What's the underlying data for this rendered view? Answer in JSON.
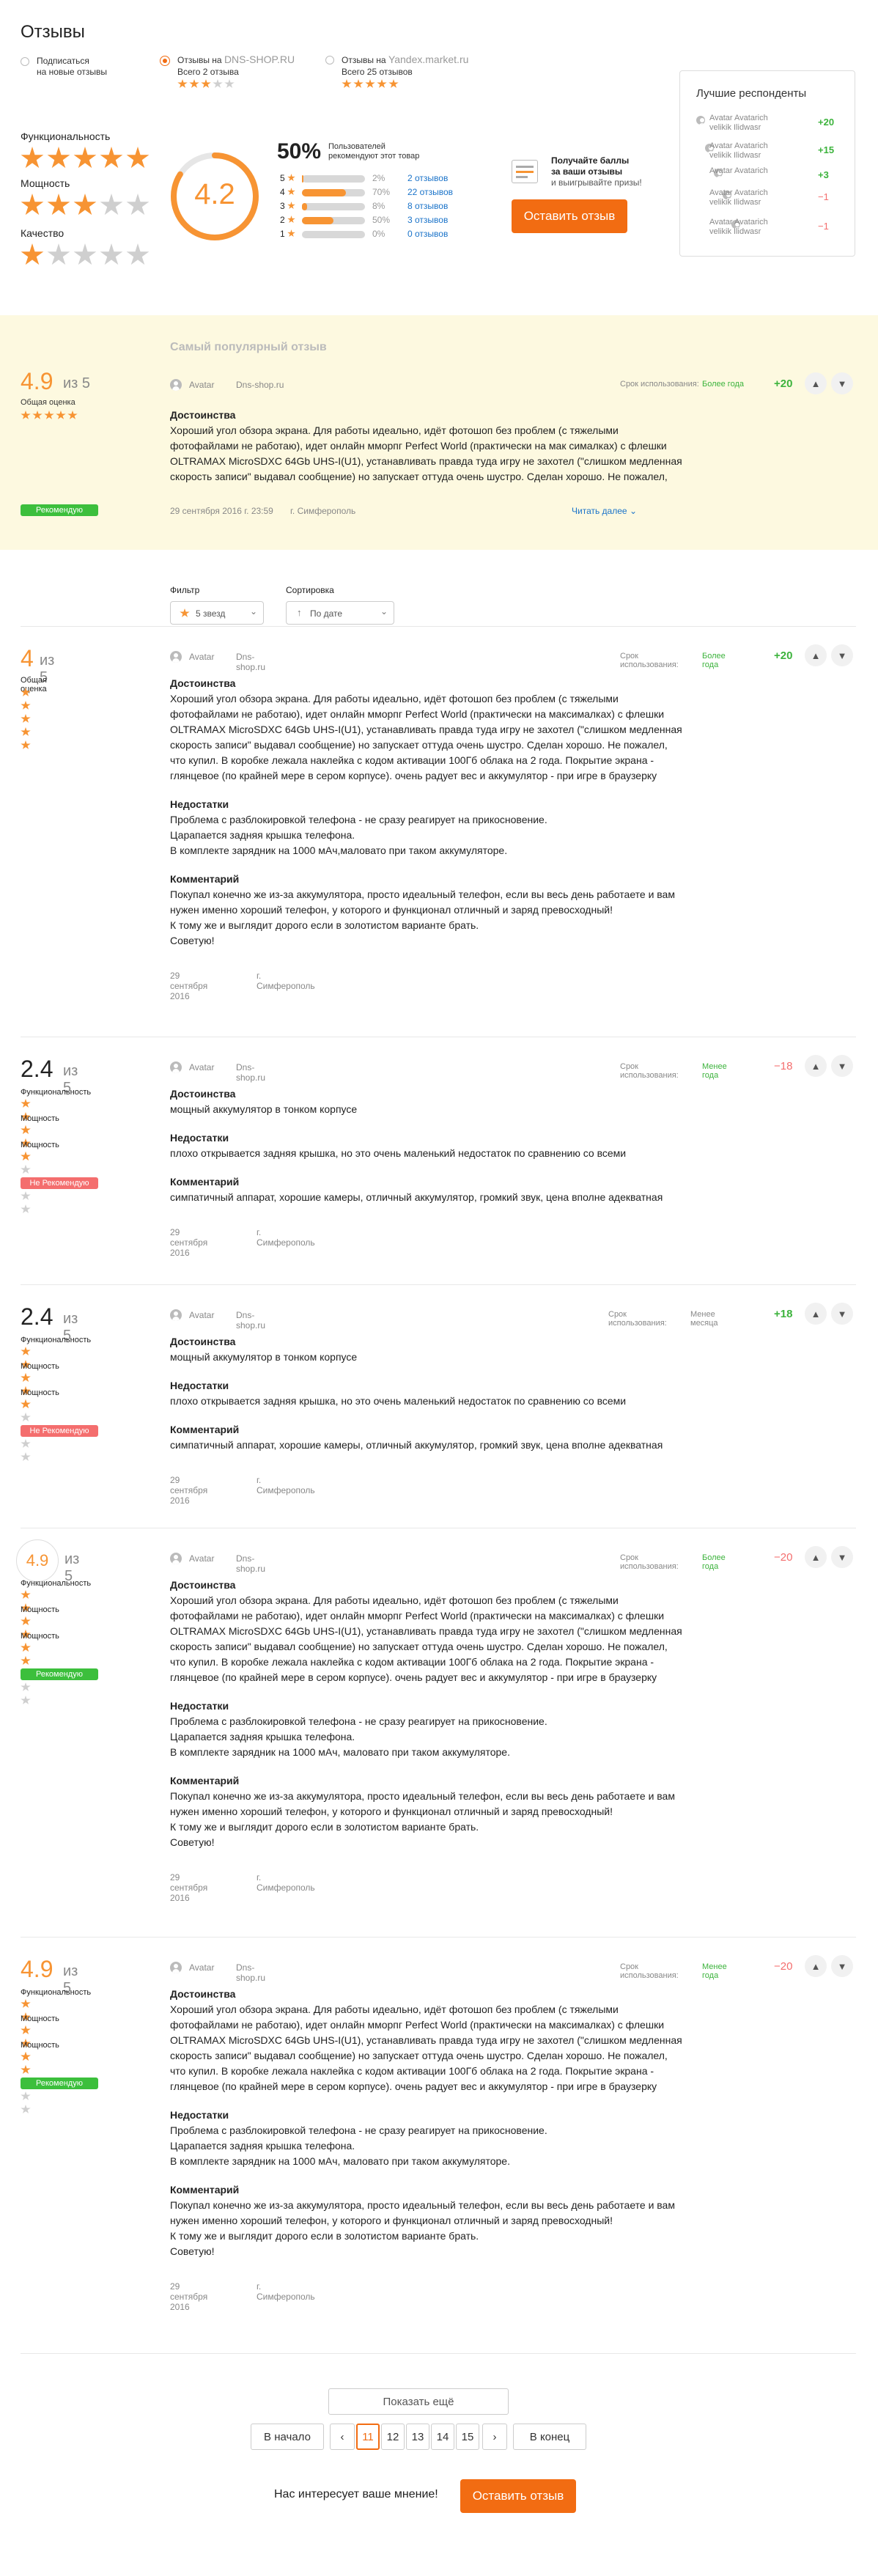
{
  "title": "Отзывы",
  "sources": {
    "subscribe": {
      "line1": "Подписаться",
      "line2": "на новые отзывы"
    },
    "dns": {
      "prefix": "Отзывы на",
      "name": "DNS-SHOP.RU",
      "total": "Всего 2 отзыва",
      "stars": 3
    },
    "yandex": {
      "prefix": "Отзывы на",
      "name": "Yandex.market.ru",
      "total": "Всего 25 отзывов",
      "stars": 5
    }
  },
  "criteria": [
    {
      "label": "Функциональность",
      "stars": 5
    },
    {
      "label": "Мощность",
      "stars": 3
    },
    {
      "label": "Качество",
      "stars": 1
    }
  ],
  "overall": {
    "score": "4.2",
    "percent": "50%",
    "percent_text_1": "Пользователей",
    "percent_text_2": "рекомендуют этот товар"
  },
  "distribution": [
    {
      "n": "5",
      "pct": "2%",
      "fill": 0.02,
      "link": "2 отзывов"
    },
    {
      "n": "4",
      "pct": "70%",
      "fill": 0.7,
      "link": "22 отзывов"
    },
    {
      "n": "3",
      "pct": "8%",
      "fill": 0.08,
      "link": "8 отзывов"
    },
    {
      "n": "2",
      "pct": "50%",
      "fill": 0.5,
      "link": "3 отзывов"
    },
    {
      "n": "1",
      "pct": "0%",
      "fill": 0,
      "link": "0 отзывов"
    }
  ],
  "promo": {
    "l1": "Получайте баллы",
    "l2": "за ваши отзывы",
    "l3": "и выигрывайте призы!"
  },
  "leave_review": "Оставить отзыв",
  "top_respondents": {
    "title": "Лучшие респонденты",
    "items": [
      {
        "l1": "Avatar Avatarich",
        "l2": "velikik Ilidwasr",
        "score": "+20",
        "type": "pos"
      },
      {
        "l1": "Avatar Avatarich",
        "l2": "velikik Ilidwasr",
        "score": "+15",
        "type": "pos"
      },
      {
        "l1": "Avatar Avatarich",
        "l2": "",
        "score": "+3",
        "type": "pos"
      },
      {
        "l1": "Avatar Avatarich",
        "l2": "velikik Ilidwasr",
        "score": "−1",
        "type": "neg"
      },
      {
        "l1": "Avatar Avatarich",
        "l2": "velikik Ilidwasr",
        "score": "−1",
        "type": "neg"
      }
    ]
  },
  "popular": {
    "label": "Самый популярный отзыв",
    "score": "4.9",
    "of": "из 5",
    "overall": "Общая оценка",
    "stars": 5,
    "badge": "Рекомендую",
    "author": "Avatar",
    "source": "Dns-shop.ru",
    "use_label": "Срок использования:",
    "use_value": "Более года",
    "votes": "+20",
    "h": "Достоинства",
    "text": [
      "Хороший угол обзора экрана. Для работы идеально, идёт фотошоп без проблем (с тяжелыми",
      "фотофайлами не работаю), идет онлайн ммоpпг Perfect World (практически на мак сималках) с флешки",
      "OLTRAMAX MicroSDXC 64Gb UHS-I(U1), устанавливать правда туда игру не захотел (\"слишком медленная",
      "скорость записи\" выдавал сообщение) но запускает оттуда очень шустро. Сделан хорошо. Не пожалел,"
    ],
    "date": "29 сентября 2016 г. 23:59",
    "city": "г. Симферополь",
    "more": "Читать далее"
  },
  "filter": {
    "label": "Фильтр",
    "value": "5 звезд"
  },
  "sort": {
    "label": "Сортировка",
    "value": "По дате"
  },
  "reviews": [
    {
      "score": "4",
      "of": "из 5",
      "overall": "Общая оценка",
      "stars": 5,
      "author": "Avatar",
      "source": "Dns-shop.ru",
      "use_label": "Срок использования:",
      "use_value": "Более года",
      "use_color": "#3cb33c",
      "votes": "+20",
      "vtype": "pos",
      "sections": [
        {
          "h": "Достоинства",
          "lines": [
            "Хороший угол обзора экрана. Для работы идеально, идёт фотошоп без проблем (с тяжелыми",
            "фотофайлами не работаю), идет онлайн ммоpпг Perfect World (практически на максималках) с флешки",
            "OLTRAMAX MicroSDXC 64Gb UHS-I(U1), устанавливать правда туда игру не захотел (\"слишком медленная",
            "скорость записи\" выдавал сообщение) но запускает оттуда очень шустро. Сделан хорошо. Не пожалел,",
            "что купил. В коробке лежала наклейка с кодом активации 100Гб облака на 2 года. Покрытие экрана -",
            "глянцевое (по крайней мере в сером корпусе). очень радует вес и аккумулятор - при игре в браузерку"
          ]
        },
        {
          "h": "Недостатки",
          "lines": [
            "Проблема с разблокировкой телефона - не сразу реагирует на прикосновение.",
            "Царапается задняя крышка телефона.",
            "В комплекте зарядник на 1000 мАч,маловато при таком аккумуляторе."
          ]
        },
        {
          "h": "Комментарий",
          "lines": [
            "Покупал конечно же из-за аккумулятора, просто идеальный телефон, если вы весь день работаете и вам",
            "нужен именно хороший телефон, у которого и функционал отличный и заряд превосходный!",
            "К тому же и выглядит дорого если в золотистом варианте брать.",
            "Советую!"
          ]
        }
      ],
      "date": "29 сентября 2016",
      "city": "г. Симферополь"
    },
    {
      "score": "2.4",
      "of": "из 5",
      "crit": [
        [
          "Функциональность",
          5
        ],
        [
          "Мощность",
          3
        ],
        [
          "Мощность",
          1
        ]
      ],
      "badge": "Не Рекомендую",
      "badge_type": "red",
      "author": "Avatar",
      "source": "Dns-shop.ru",
      "use_label": "Срок использования:",
      "use_value": "Менее года",
      "use_color": "#3cb33c",
      "votes": "−18",
      "vtype": "neg",
      "sections": [
        {
          "h": "Достоинства",
          "lines": [
            "мощный аккумулятор в тонком корпусе"
          ]
        },
        {
          "h": "Недостатки",
          "lines": [
            "плохо открывается задняя крышка, но это очень маленький недостаток по сравнению со всеми"
          ]
        },
        {
          "h": "Комментарий",
          "lines": [
            "симпатичный аппарат, хорошие камеры, отличный аккумулятор, громкий звук, цена вполне адекватная"
          ]
        }
      ],
      "date": "29 сентября 2016",
      "city": "г. Симферополь"
    },
    {
      "score": "2.4",
      "of": "из 5",
      "crit": [
        [
          "Функциональность",
          5
        ],
        [
          "Мощность",
          3
        ],
        [
          "Мощность",
          1
        ]
      ],
      "badge": "Не Рекомендую",
      "badge_type": "red",
      "author": "Avatar",
      "source": "Dns-shop.ru",
      "use_label": "Срок использования:",
      "use_value": "Менее месяца",
      "use_color": "#888",
      "votes": "+18",
      "vtype": "pos",
      "sections": [
        {
          "h": "Достоинства",
          "lines": [
            "мощный аккумулятор в тонком корпусе"
          ]
        },
        {
          "h": "Недостатки",
          "lines": [
            "плохо открывается задняя крышка, но это очень маленький недостаток по сравнению со всеми"
          ]
        },
        {
          "h": "Комментарий",
          "lines": [
            "симпатичный аппарат, хорошие камеры, отличный аккумулятор, громкий звук, цена вполне адекватная"
          ]
        }
      ],
      "date": "29 сентября 2016",
      "city": "г. Симферополь"
    },
    {
      "score": "4.9",
      "of": "из 5",
      "circle": true,
      "crit": [
        [
          "Функциональность",
          5
        ],
        [
          "Мощность",
          3
        ],
        [
          "Мощность",
          3
        ]
      ],
      "badge": "Рекомендую",
      "badge_type": "green",
      "author": "Avatar",
      "source": "Dns-shop.ru",
      "use_label": "Срок использования:",
      "use_value": "Более года",
      "use_color": "#3cb33c",
      "votes": "−20",
      "vtype": "neg",
      "sections": [
        {
          "h": "Достоинства",
          "lines": [
            "Хороший угол обзора экрана. Для работы идеально, идёт фотошоп без проблем (с тяжелыми",
            "фотофайлами не работаю), идет онлайн ммоpпг Perfect World (практически на максималках) с флешки",
            "OLTRAMAX MicroSDXC 64Gb UHS-I(U1), устанавливать правда туда игру не захотел (\"слишком медленная",
            "скорость записи\" выдавал сообщение) но запускает оттуда очень шустро. Сделан хорошо. Не пожалел,",
            "что купил. В коробке лежала наклейка с кодом активации 100Гб облака на 2 года. Покрытие экрана -",
            "глянцевое (по крайней мере в сером корпусе). очень радует вес и аккумулятор - при игре в браузерку"
          ]
        },
        {
          "h": "Недостатки",
          "lines": [
            "Проблема с разблокировкой телефона - не сразу реагирует на прикосновение.",
            "Царапается задняя крышка телефона.",
            "В комплекте зарядник на 1000 мАч, маловато при таком аккумуляторе."
          ]
        },
        {
          "h": "Комментарий",
          "lines": [
            "Покупал конечно же из-за аккумулятора, просто идеальный телефон, если вы весь день работаете и вам",
            "нужен именно хороший телефон, у которого и функционал отличный и заряд превосходный!",
            "К тому же и выглядит дорого если в золотистом варианте брать.",
            "Советую!"
          ]
        }
      ],
      "date": "29 сентября 2016",
      "city": "г. Симферополь"
    },
    {
      "score": "4.9",
      "of": "из 5",
      "crit": [
        [
          "Функциональность",
          5
        ],
        [
          "Мощность",
          3
        ],
        [
          "Мощность",
          3
        ]
      ],
      "badge": "Рекомендую",
      "badge_type": "green",
      "author": "Avatar",
      "source": "Dns-shop.ru",
      "use_label": "Срок использования:",
      "use_value": "Менее года",
      "use_color": "#3cb33c",
      "votes": "−20",
      "vtype": "neg",
      "sections": [
        {
          "h": "Достоинства",
          "lines": [
            "Хороший угол обзора экрана. Для работы идеально, идёт фотошоп без проблем (с тяжелыми",
            "фотофайлами не работаю), идет онлайн ммоpпг Perfect World (практически на максималках) с флешки",
            "OLTRAMAX MicroSDXC 64Gb UHS-I(U1), устанавливать правда туда игру не захотел (\"слишком медленная",
            "скорость записи\" выдавал сообщение) но запускает оттуда очень шустро. Сделан хорошо. Не пожалел,",
            "что купил. В коробке лежала наклейка с кодом активации 100Гб облака на 2 года. Покрытие экрана -",
            "глянцевое (по крайней мере в сером корпусе). очень радует вес и аккумулятор - при игре в браузерку"
          ]
        },
        {
          "h": "Недостатки",
          "lines": [
            "Проблема с разблокировкой телефона - не сразу реагирует на прикосновение.",
            "Царапается задняя крышка телефона.",
            "В комплекте зарядник на 1000 мАч, маловато при таком аккумуляторе."
          ]
        },
        {
          "h": "Комментарий",
          "lines": [
            "Покупал конечно же из-за аккумулятора, просто идеальный телефон, если вы весь день работаете и вам",
            "нужен именно хороший телефон, у которого и функционал отличный и заряд превосходный!",
            "К тому же и выглядит дорого если в золотистом варианте брать.",
            "Советую!"
          ]
        }
      ],
      "date": "29 сентября 2016",
      "city": "г. Симферополь"
    }
  ],
  "show_more": "Показать ещё",
  "pagination": {
    "first": "В начало",
    "last": "В конец",
    "prev": "‹",
    "next": "›",
    "pages": [
      "11",
      "12",
      "13",
      "14",
      "15"
    ],
    "current": "11"
  },
  "bottom": {
    "text": "Нас интересует ваше мнение!",
    "button": "Оставить отзыв"
  }
}
